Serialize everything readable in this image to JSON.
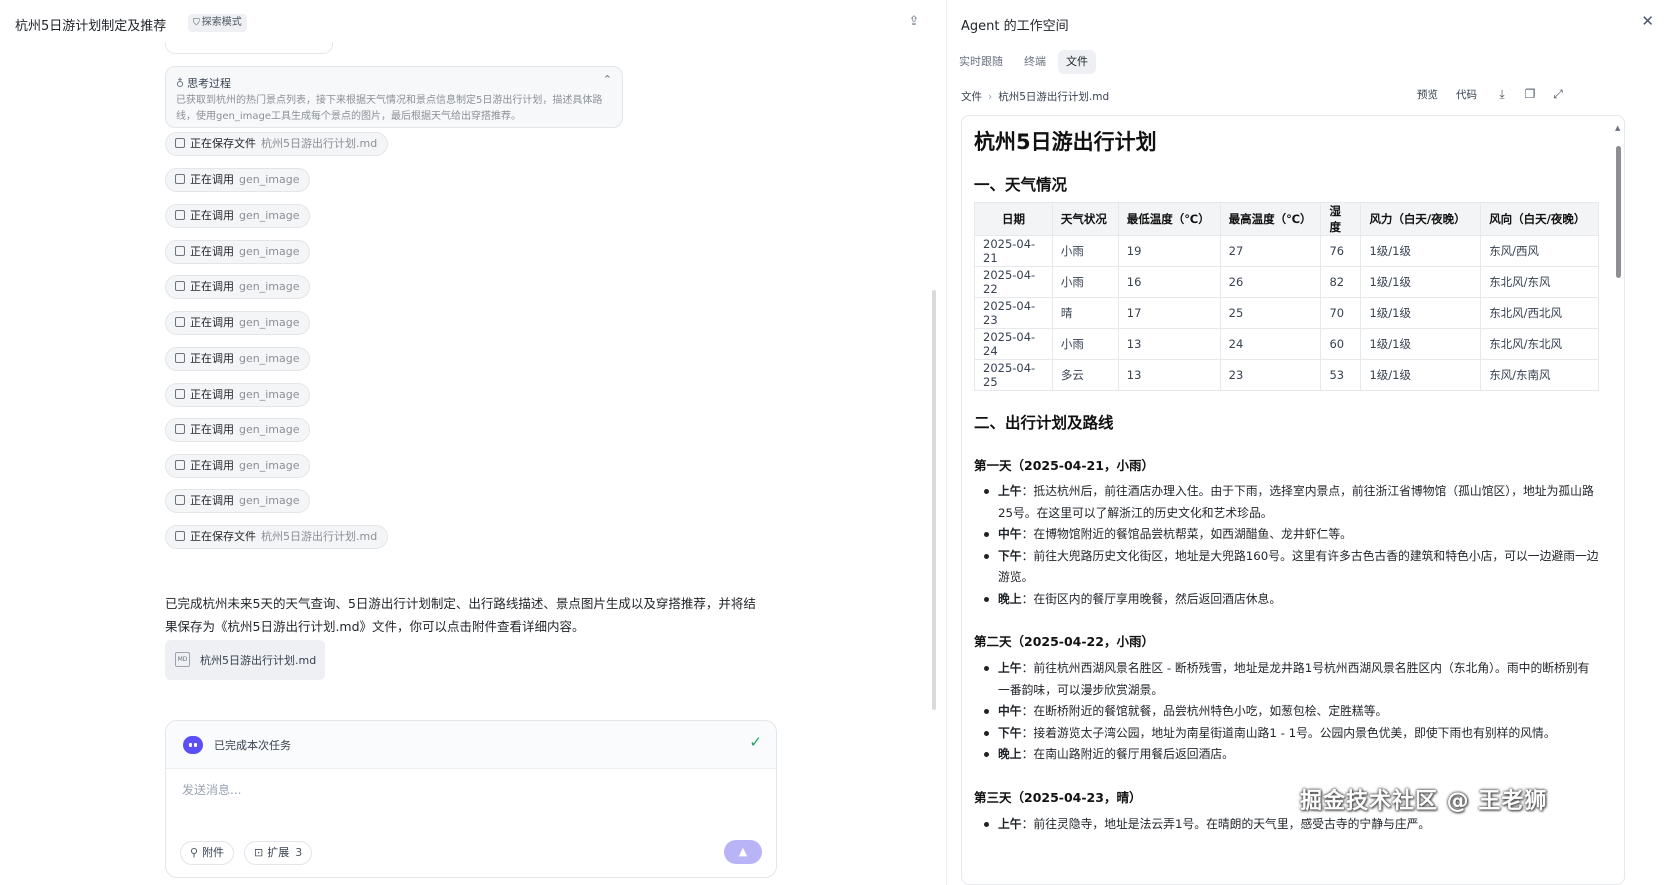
{
  "left": {
    "title": "杭州5日游计划制定及推荐",
    "mode_badge": "探索模式",
    "think": {
      "title": "思考过程",
      "body": "已获取到杭州的热门景点列表，接下来根据天气情况和景点信息制定5日游出行计划，描述具体路线，使用gen_image工具生成每个景点的图片，最后根据天气给出穿搭推荐。"
    },
    "steps": [
      {
        "label": "正在保存文件",
        "arg": "杭州5日游出行计划.md"
      },
      {
        "label": "正在调用",
        "arg": "gen_image"
      },
      {
        "label": "正在调用",
        "arg": "gen_image"
      },
      {
        "label": "正在调用",
        "arg": "gen_image"
      },
      {
        "label": "正在调用",
        "arg": "gen_image"
      },
      {
        "label": "正在调用",
        "arg": "gen_image"
      },
      {
        "label": "正在调用",
        "arg": "gen_image"
      },
      {
        "label": "正在调用",
        "arg": "gen_image"
      },
      {
        "label": "正在调用",
        "arg": "gen_image"
      },
      {
        "label": "正在调用",
        "arg": "gen_image"
      },
      {
        "label": "正在调用",
        "arg": "gen_image"
      },
      {
        "label": "正在保存文件",
        "arg": "杭州5日游出行计划.md"
      }
    ],
    "final_text_1": "已完成杭州未来5天的天气查询、5日游出行计划制定、出行路线描述、景点图片生成以及穿搭推荐，并将结",
    "final_text_2": "果保存为《杭州5日游出行计划.md》文件，你可以点击附件查看详细内容。",
    "attachment": {
      "icon_text": "MD",
      "name": "杭州5日游出行计划.md"
    },
    "composer": {
      "task_status": "已完成本次任务",
      "placeholder": "发送消息...",
      "attach_label": "附件",
      "expand_label": "扩展",
      "expand_count": "3"
    }
  },
  "right": {
    "title": "Agent 的工作空间",
    "tabs": [
      "实时跟随",
      "终端",
      "文件"
    ],
    "active_tab": "文件",
    "breadcrumb_root": "文件",
    "breadcrumb_file": "杭州5日游出行计划.md",
    "toolbar": {
      "preview": "预览",
      "code": "代码"
    },
    "doc": {
      "h1": "杭州5日游出行计划",
      "h2_weather": "一、天气情况",
      "table_headers": [
        "日期",
        "天气状况",
        "最低温度（℃）",
        "最高温度（℃）",
        "湿度",
        "风力（白天/夜晚）",
        "风向（白天/夜晚）"
      ],
      "table_rows": [
        [
          "2025-04-21",
          "小雨",
          "19",
          "27",
          "76",
          "1级/1级",
          "东风/西风"
        ],
        [
          "2025-04-22",
          "小雨",
          "16",
          "26",
          "82",
          "1级/1级",
          "东北风/东风"
        ],
        [
          "2025-04-23",
          "晴",
          "17",
          "25",
          "70",
          "1级/1级",
          "东北风/西北风"
        ],
        [
          "2025-04-24",
          "小雨",
          "13",
          "24",
          "60",
          "1级/1级",
          "东北风/东北风"
        ],
        [
          "2025-04-25",
          "多云",
          "13",
          "23",
          "53",
          "1级/1级",
          "东风/东南风"
        ]
      ],
      "h2_plan": "二、出行计划及路线",
      "days": [
        {
          "title": "第一天（2025-04-21，小雨）",
          "items": [
            {
              "k": "上午",
              "v": "：抵达杭州后，前往酒店办理入住。由于下雨，选择室内景点，前往浙江省博物馆（孤山馆区），地址为孤山路25号。在这里可以了解浙江的历史文化和艺术珍品。"
            },
            {
              "k": "中午",
              "v": "：在博物馆附近的餐馆品尝杭帮菜，如西湖醋鱼、龙井虾仁等。"
            },
            {
              "k": "下午",
              "v": "：前往大兜路历史文化街区，地址是大兜路160号。这里有许多古色古香的建筑和特色小店，可以一边避雨一边游览。"
            },
            {
              "k": "晚上",
              "v": "：在街区内的餐厅享用晚餐，然后返回酒店休息。"
            }
          ]
        },
        {
          "title": "第二天（2025-04-22，小雨）",
          "items": [
            {
              "k": "上午",
              "v": "：前往杭州西湖风景名胜区 - 断桥残雪，地址是龙井路1号杭州西湖风景名胜区内（东北角）。雨中的断桥别有一番韵味，可以漫步欣赏湖景。"
            },
            {
              "k": "中午",
              "v": "：在断桥附近的餐馆就餐，品尝杭州特色小吃，如葱包桧、定胜糕等。"
            },
            {
              "k": "下午",
              "v": "：接着游览太子湾公园，地址为南星街道南山路1 - 1号。公园内景色优美，即使下雨也有别样的风情。"
            },
            {
              "k": "晚上",
              "v": "：在南山路附近的餐厅用餐后返回酒店。"
            }
          ]
        },
        {
          "title": "第三天（2025-04-23，晴）",
          "items": [
            {
              "k": "上午",
              "v": "：前往灵隐寺，地址是法云弄1号。在晴朗的天气里，感受古寺的宁静与庄严。"
            }
          ]
        }
      ]
    }
  },
  "watermark": "掘金技术社区 @ 王老狮"
}
